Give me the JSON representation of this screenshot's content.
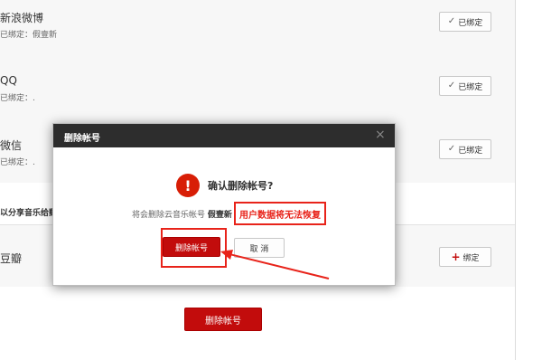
{
  "accounts": [
    {
      "name": "新浪微博",
      "status": "已绑定：假壹新",
      "button": "已绑定"
    },
    {
      "name": "QQ",
      "status": "已绑定：.",
      "button": "已绑定"
    },
    {
      "name": "微信",
      "status": "已绑定：.",
      "button": "已绑定"
    }
  ],
  "share_label": "以分享音乐给郵亚",
  "douban": {
    "name": "豆瓣",
    "button": "绑定"
  },
  "delete_account_button": "删除帐号",
  "dialog": {
    "title": "删除帐号",
    "confirm_title": "确认删除帐号?",
    "message_prefix": "将会删除云音乐帐号",
    "account_name": "假壹新",
    "warning": "用户数据将无法恢复",
    "delete_button": "删除帐号",
    "cancel_button": "取 消"
  },
  "colors": {
    "brand_red": "#c20c0c",
    "annotation_red": "#e8231a",
    "header_dark": "#2d2d2d"
  }
}
